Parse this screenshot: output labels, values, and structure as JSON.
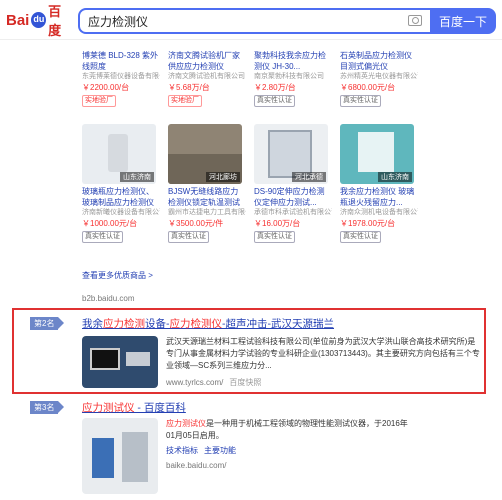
{
  "header": {
    "logo_prefix": "Bai",
    "logo_suffix": "百度",
    "query": "应力检测仪",
    "search_button": "百度一下"
  },
  "products": [
    {
      "title": "博莱德 BLD-328 紫外线照度",
      "shop": "东莞博莱德仪器设备有限公司",
      "price": "￥2200.00/台",
      "tag": "实地验厂",
      "tag_style": "red",
      "region": ""
    },
    {
      "title": "济南文腾试验机厂家供应应力检测仪",
      "shop": "济南文腾试验机有限公司",
      "price": "￥5.68万/台",
      "tag": "实地验厂",
      "tag_style": "red",
      "region": ""
    },
    {
      "title": "聚勃科技我余应力检测仪 JH-30...",
      "shop": "南京聚勃科技有限公司",
      "price": "￥2.80万/台",
      "tag": "真实性认证",
      "tag_style": "gray",
      "region": ""
    },
    {
      "title": "石英制品应力检测仪目测式偏光仪",
      "shop": "苏州精英光电仪器有限公司",
      "price": "￥6800.00元/台",
      "tag": "真实性认证",
      "tag_style": "gray",
      "region": ""
    },
    {
      "title": "玻璃瓶应力检测仪、玻璃制品应力检测仪",
      "shop": "济南新曦仪器设备有限公司",
      "price": "￥1000.00元/台",
      "tag": "真实性认证",
      "tag_style": "gray",
      "region": "山东济南"
    },
    {
      "title": "BJSW无缝线路应力检测仪锁定轨温测试仪",
      "shop": "霸州市达捷电力工具有限公司",
      "price": "￥3500.00元/件",
      "tag": "真实性认证",
      "tag_style": "gray",
      "region": "河北廊坊"
    },
    {
      "title": "DS-90定伸应力检测仪定伸应力测试...",
      "shop": "承德市科承试验机有限公司",
      "price": "￥16.00万/台",
      "tag": "真实性认证",
      "tag_style": "gray",
      "region": "河北承德"
    },
    {
      "title": "我余应力检测仪 玻璃瓶退火残留应力...",
      "shop": "济南众测机电设备有限公司",
      "price": "￥1978.00元/台",
      "tag": "真实性认证",
      "tag_style": "gray",
      "region": "山东济南"
    }
  ],
  "more_link": "查看更多优质商品 >",
  "site1": "b2b.baidu.com",
  "result2": {
    "rank": "第2名",
    "title_prefix": "我余",
    "title_em": "应力检测",
    "title_mid": "设备-",
    "title_em2": "应力检测仪",
    "title_suffix": "-超声冲击-武汉天源瑞兰",
    "desc": "武汉天源瑞兰材料工程试验科技有限公司(单位前身为武汉大学洪山联合高技术研究所)是专门从事金属材料力学试验的专业科研企业(1303713443)。其主要研究方向包括有三个专业领域—SC系列三维应力分...",
    "url": "www.tyrlcs.com/",
    "snapshot": "百度快照"
  },
  "result3": {
    "rank": "第3名",
    "title_em": "应力测试仪",
    "title_suffix": " - 百度百科",
    "desc_em": "应力测试仪",
    "desc": "是一种用于机械工程领域的物理性能测试仪器，于2016年01月05日启用。",
    "sub_links": [
      "技术指标",
      "主要功能"
    ],
    "url": "baike.baidu.com/"
  },
  "colors": {
    "accent": "#4e6ef2",
    "link": "#2440b3",
    "highlight": "#f73131",
    "box": "#e03131"
  }
}
